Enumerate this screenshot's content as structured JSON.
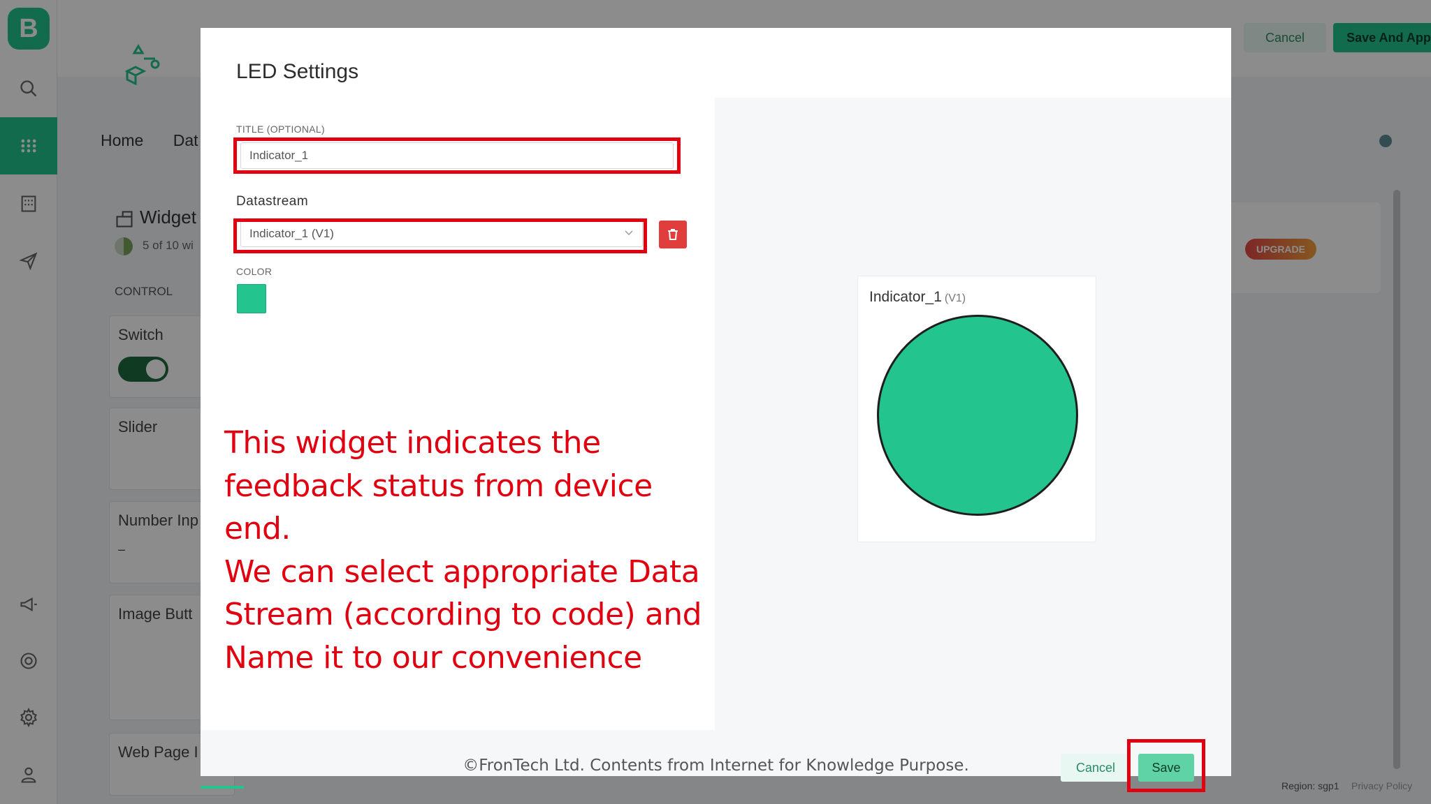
{
  "background": {
    "sidebar": {
      "logo": "B"
    },
    "header": {
      "cancel_label": "Cancel",
      "save_apply_label": "Save And Apply"
    },
    "nav": [
      "Home",
      "Dat"
    ],
    "widget_box": {
      "title": "Widget",
      "count": "5 of 10 wi",
      "section": "CONTROL",
      "widgets": [
        "Switch",
        "Slider",
        "Number Inp",
        "Image Butt",
        "Web Page I"
      ],
      "number_input_value": "–"
    },
    "upgrade_badge": "UPGRADE",
    "footer": {
      "region": "Region: sgp1",
      "privacy": "Privacy Policy"
    }
  },
  "modal": {
    "title": "LED Settings",
    "title_field": {
      "caption": "TITLE (OPTIONAL)",
      "value": "Indicator_1"
    },
    "datastream": {
      "caption": "Datastream",
      "value": "Indicator_1 (V1)"
    },
    "color": {
      "caption": "COLOR",
      "value": "#23c48e"
    },
    "preview": {
      "label": "Indicator_1",
      "pin": "(V1)"
    },
    "buttons": {
      "cancel": "Cancel",
      "save": "Save"
    }
  },
  "annotation": {
    "lines": [
      "This widget indicates the",
      "feedback status from device end.",
      "We can select appropriate Data",
      "Stream (according to code) and",
      "Name it to our convenience"
    ],
    "color": "#e1000f"
  },
  "copyright": "©FronTech Ltd. Contents from Internet for Knowledge Purpose."
}
